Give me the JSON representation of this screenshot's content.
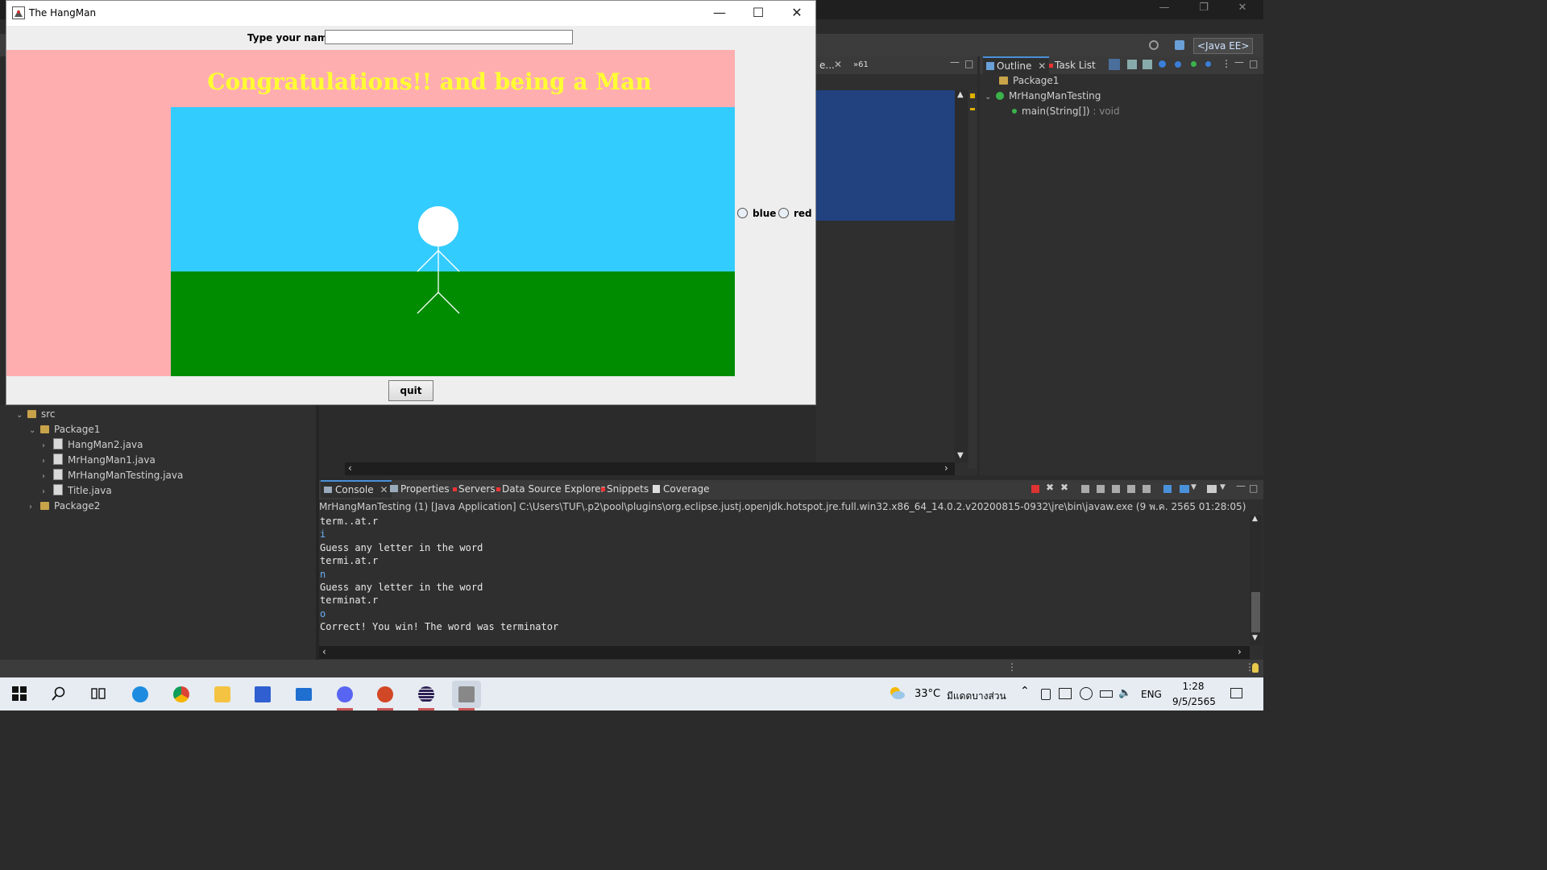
{
  "ide": {
    "perspective": "<Java EE>",
    "editor_tabs": [
      "e...",
      "»61"
    ],
    "outline": {
      "tabs": [
        "Outline",
        "Task List"
      ],
      "items": [
        {
          "label": "Package1"
        },
        {
          "label": "MrHangManTesting"
        },
        {
          "label": "main(String[])",
          "suffix": " : void"
        }
      ]
    },
    "explorer": {
      "items": [
        {
          "label": "src",
          "level": 0,
          "expanded": true
        },
        {
          "label": "Package1",
          "level": 1,
          "expanded": true
        },
        {
          "label": "HangMan2.java",
          "level": 2
        },
        {
          "label": "MrHangMan1.java",
          "level": 2
        },
        {
          "label": "MrHangManTesting.java",
          "level": 2
        },
        {
          "label": "Title.java",
          "level": 2
        },
        {
          "label": "Package2",
          "level": 1,
          "expanded": false
        }
      ]
    },
    "console": {
      "tabs": [
        "Console",
        "Properties",
        "Servers",
        "Data Source Explorer",
        "Snippets",
        "Coverage"
      ],
      "header": "MrHangManTesting (1) [Java Application] C:\\Users\\TUF\\.p2\\pool\\plugins\\org.eclipse.justj.openjdk.hotspot.jre.full.win32.x86_64_14.0.2.v20200815-0932\\jre\\bin\\javaw.exe  (9 พ.ค. 2565 01:28:05)",
      "lines": [
        {
          "text": "term..at.r",
          "input": false
        },
        {
          "text": "i",
          "input": true
        },
        {
          "text": "Guess any letter in the word",
          "input": false
        },
        {
          "text": "termi.at.r",
          "input": false
        },
        {
          "text": "n",
          "input": true
        },
        {
          "text": "Guess any letter in the word",
          "input": false
        },
        {
          "text": "terminat.r",
          "input": false
        },
        {
          "text": "o",
          "input": true
        },
        {
          "text": "Correct! You win! The word was terminator",
          "input": false
        }
      ]
    }
  },
  "hangman": {
    "title": "The HangMan",
    "name_label": "Type your name",
    "name_value": "",
    "banner": "Congratulations!! and being a Man",
    "radios": [
      {
        "label": "blue",
        "checked": false
      },
      {
        "label": "red",
        "checked": false
      }
    ],
    "quit_label": "quit",
    "colors": {
      "banner_bg": "#ffaeb0",
      "banner_text": "#ffff33",
      "sky": "#33ccff",
      "grass": "#008c00"
    }
  },
  "taskbar": {
    "apps": [
      {
        "name": "search-icon"
      },
      {
        "name": "task-view-icon"
      },
      {
        "name": "edge-icon",
        "color": "#1d8ce0"
      },
      {
        "name": "chrome-icon",
        "color": "#db4437"
      },
      {
        "name": "file-explorer-icon",
        "color": "#f5c342"
      },
      {
        "name": "app-icon",
        "color": "#2f5fd0"
      },
      {
        "name": "mail-icon",
        "color": "#1f6fd0"
      },
      {
        "name": "discord-icon",
        "color": "#5865f2"
      },
      {
        "name": "powerpoint-icon",
        "color": "#d24726"
      },
      {
        "name": "eclipse-icon",
        "color": "#2c2255"
      },
      {
        "name": "java-app-icon",
        "color": "#888888"
      }
    ],
    "weather_temp": "33°C",
    "weather_desc": "มีแดดบางส่วน",
    "language": "ENG",
    "time": "1:28",
    "date": "9/5/2565"
  }
}
